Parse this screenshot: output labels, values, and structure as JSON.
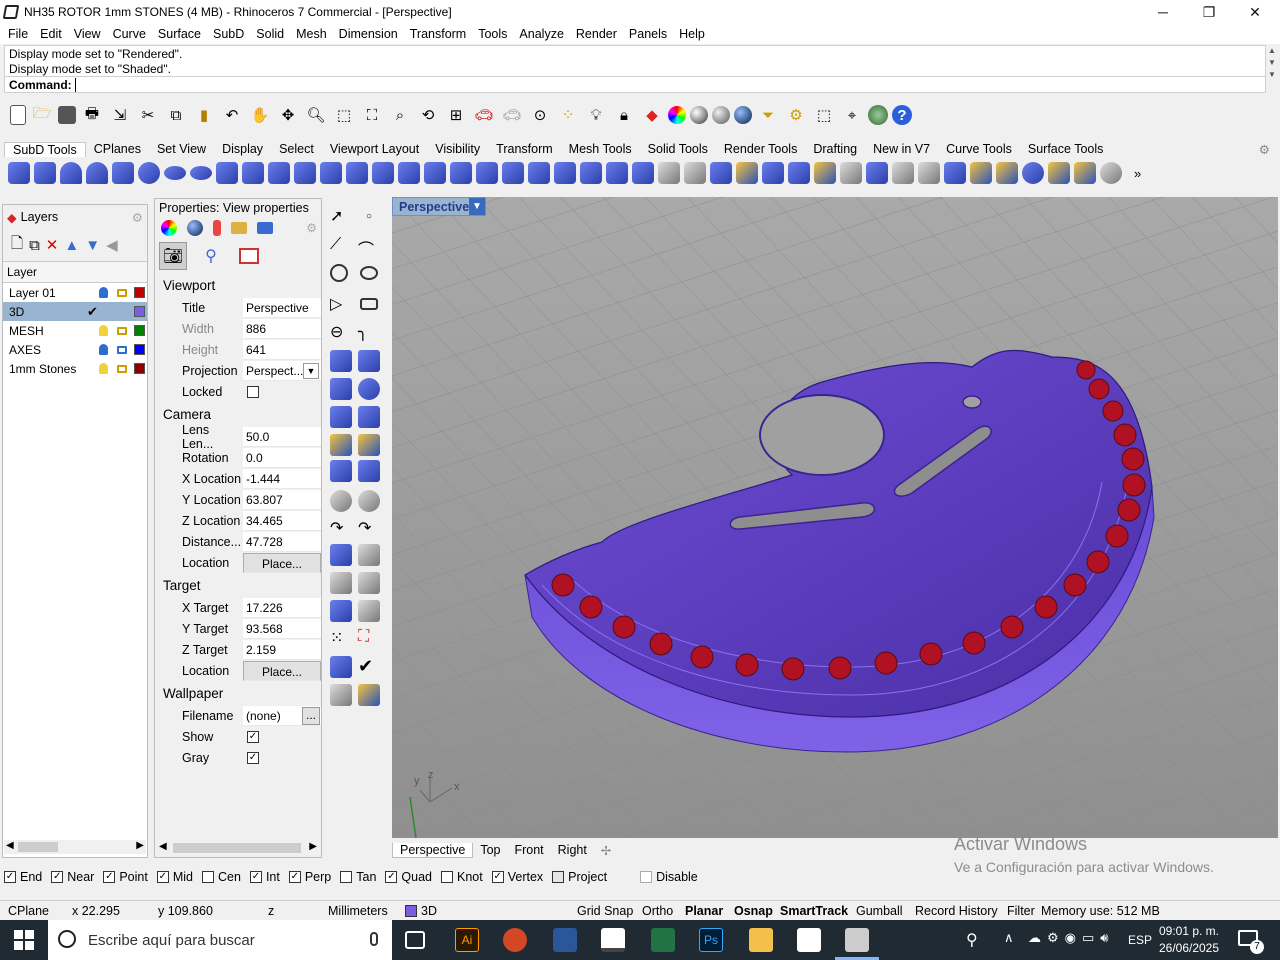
{
  "window": {
    "title": "NH35 ROTOR 1mm STONES (4 MB) - Rhinoceros 7 Commercial - [Perspective]",
    "minimize": "─",
    "maximize": "❐",
    "close": "✕"
  },
  "menu": [
    "File",
    "Edit",
    "View",
    "Curve",
    "Surface",
    "SubD",
    "Solid",
    "Mesh",
    "Dimension",
    "Transform",
    "Tools",
    "Analyze",
    "Render",
    "Panels",
    "Help"
  ],
  "command": {
    "history": [
      "Display mode set to \"Rendered\".",
      "Display mode set to \"Shaded\"."
    ],
    "label": "Command:",
    "value": ""
  },
  "tabs": [
    "SubD Tools",
    "CPlanes",
    "Set View",
    "Display",
    "Select",
    "Viewport Layout",
    "Visibility",
    "Transform",
    "Mesh Tools",
    "Solid Tools",
    "Render Tools",
    "Drafting",
    "New in V7",
    "Curve Tools",
    "Surface Tools"
  ],
  "active_tab": "SubD Tools",
  "layers": {
    "title": "Layers",
    "column": "Layer",
    "rows": [
      {
        "name": "Layer 01",
        "current": false,
        "color": "#c00000"
      },
      {
        "name": "3D",
        "current": true,
        "color": "#7a5de0"
      },
      {
        "name": "MESH",
        "current": false,
        "color": "#008000"
      },
      {
        "name": "AXES",
        "current": false,
        "color": "#0000ff"
      },
      {
        "name": "1mm Stones",
        "current": false,
        "color": "#8b0000"
      }
    ]
  },
  "properties": {
    "title": "Properties: View properties",
    "viewport": {
      "section": "Viewport",
      "title_label": "Title",
      "title": "Perspective",
      "width_label": "Width",
      "width": "886",
      "height_label": "Height",
      "height": "641",
      "projection_label": "Projection",
      "projection": "Perspect...",
      "locked_label": "Locked"
    },
    "camera": {
      "section": "Camera",
      "lens_label": "Lens Len...",
      "lens": "50.0",
      "rotation_label": "Rotation",
      "rotation": "0.0",
      "x_label": "X Location",
      "x": "-1.444",
      "y_label": "Y Location",
      "y": "63.807",
      "z_label": "Z Location",
      "z": "34.465",
      "dist_label": "Distance...",
      "dist": "47.728",
      "loc_label": "Location",
      "place": "Place..."
    },
    "target": {
      "section": "Target",
      "x_label": "X Target",
      "x": "17.226",
      "y_label": "Y Target",
      "y": "93.568",
      "z_label": "Z Target",
      "z": "2.159",
      "loc_label": "Location",
      "place": "Place..."
    },
    "wallpaper": {
      "section": "Wallpaper",
      "file_label": "Filename",
      "file": "(none)",
      "browse": "...",
      "show_label": "Show",
      "gray_label": "Gray"
    }
  },
  "viewport": {
    "name": "Perspective",
    "tabs": [
      "Perspective",
      "Top",
      "Front",
      "Right"
    ],
    "add": "✢",
    "axis_x": "x",
    "axis_y": "y",
    "axis_z": "z"
  },
  "activate": {
    "line1": "Activar Windows",
    "line2": "Ve a Configuración para activar Windows."
  },
  "osnap": [
    {
      "label": "End",
      "on": true
    },
    {
      "label": "Near",
      "on": true
    },
    {
      "label": "Point",
      "on": true
    },
    {
      "label": "Mid",
      "on": true
    },
    {
      "label": "Cen",
      "on": false
    },
    {
      "label": "Int",
      "on": true
    },
    {
      "label": "Perp",
      "on": true
    },
    {
      "label": "Tan",
      "on": false
    },
    {
      "label": "Quad",
      "on": true
    },
    {
      "label": "Knot",
      "on": false
    },
    {
      "label": "Vertex",
      "on": true
    },
    {
      "label": "Project",
      "on": false
    },
    {
      "label": "Disable",
      "on": false
    }
  ],
  "status": {
    "cplane": "CPlane",
    "x": "x 22.295",
    "y": "y 109.860",
    "z": "z",
    "units": "Millimeters",
    "layer": "3D",
    "grid_snap": "Grid Snap",
    "ortho": "Ortho",
    "planar": "Planar",
    "osnap": "Osnap",
    "smarttrack": "SmartTrack",
    "gumball": "Gumball",
    "history": "Record History",
    "filter": "Filter",
    "memory": "Memory use: 512 MB"
  },
  "taskbar": {
    "search": "Escribe aquí para buscar",
    "lang": "ESP",
    "time": "09:01 p. m.",
    "date": "26/06/2025",
    "notif": "7"
  }
}
